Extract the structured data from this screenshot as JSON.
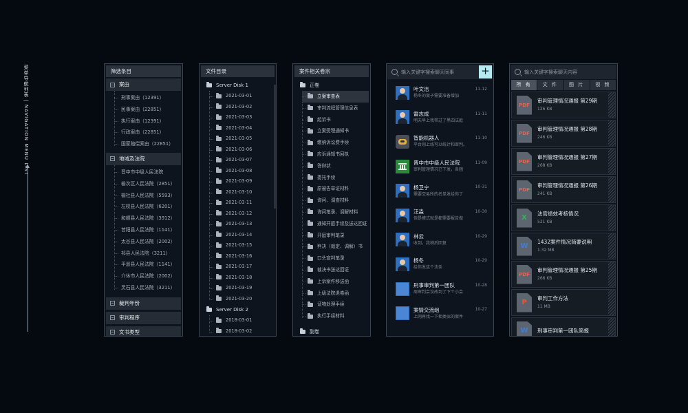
{
  "caption": "菜单导航列表 | NAVIGATION MENU LIST",
  "filter_panel": {
    "title": "筛选条目",
    "groups": [
      {
        "label": "案由",
        "items": [
          "刑事案由（12391）",
          "民事案由（22851）",
          "执行案由（12391）",
          "行政案由（22851）",
          "国家赔偿案由（22851）"
        ]
      },
      {
        "label": "地域及法院",
        "items": [
          "晋中市中级人民法院",
          "榆次区人民法院（2851）",
          "榆社县人民法院（5593）",
          "左权县人民法院（6201）",
          "和顺县人民法院（3912）",
          "昔阳县人民法院（1141）",
          "太谷县人民法院（2002）",
          "祁县人民法院（3211）",
          "平遥县人民法院（1141）",
          "介休市人民法院（2002）",
          "灵石县人民法院（3211）"
        ]
      }
    ],
    "collapsed": [
      "裁判年份",
      "审判程序",
      "文书类型"
    ]
  },
  "file_dir_panel": {
    "title": "文件目录",
    "disks": [
      {
        "name": "Server Disk 1",
        "dates": [
          "2021-03-01",
          "2021-03-02",
          "2021-03-03",
          "2021-03-04",
          "2021-03-05",
          "2021-03-06",
          "2021-03-07",
          "2021-03-08",
          "2021-03-09",
          "2021-03-10",
          "2021-03-11",
          "2021-03-12",
          "2021-03-13",
          "2021-03-14",
          "2021-03-15",
          "2021-03-16",
          "2021-03-17",
          "2021-03-18",
          "2021-03-19",
          "2021-03-20"
        ]
      },
      {
        "name": "Server Disk 2",
        "dates": [
          "2018-03-01",
          "2018-03-02"
        ]
      }
    ]
  },
  "case_panel": {
    "title": "案件相关卷宗",
    "main_volume": "正卷",
    "items": [
      "立案审查表",
      "审判流程管理信息表",
      "起诉书",
      "立案受理通知书",
      "缴纳诉讼费手续",
      "应诉通知书回执",
      "答辩状",
      "委托手续",
      "原被告举证材料",
      "询问、调查材料",
      "询问笔录、调解材料",
      "通知开庭手续及送达回证",
      "开庭审判笔录",
      "判决（裁定、调解）书",
      "口头宣判笔录",
      "裁决书送达回证",
      "上诉案件移送函",
      "上级法院退卷函",
      "证物处理手续",
      "执行手续材料"
    ],
    "active_index": 0,
    "sub_volume": "副卷"
  },
  "chat_panel": {
    "search_placeholder": "输入关键字搜索聊天同事",
    "add_symbol": "+",
    "contacts": [
      {
        "name": "叶文洁",
        "msg": "杨冬的案子需要准备增加",
        "date": "11-12",
        "avatar": "person"
      },
      {
        "name": "雷志成",
        "msg": "明天早上我带过了黑四法庭",
        "date": "11-11",
        "avatar": "person"
      },
      {
        "name": "智能机器人",
        "msg": "平台刚上线可以统计和审判。",
        "date": "11-10",
        "avatar": "robot"
      },
      {
        "name": "晋中市中级人民法院",
        "msg": "审判管理情况已下发，各团",
        "date": "11-09",
        "avatar": "court"
      },
      {
        "name": "杨卫宁",
        "msg": "需要交易所的名单发给你了",
        "date": "10-31",
        "avatar": "person"
      },
      {
        "name": "汪淼",
        "msg": "但是模式就是都需要报告做",
        "date": "10-30",
        "avatar": "person"
      },
      {
        "name": "林云",
        "msg": "收到，我稍后回复",
        "date": "10-29",
        "avatar": "person"
      },
      {
        "name": "杨冬",
        "msg": "给你发这个法条",
        "date": "10-29",
        "avatar": "person"
      },
      {
        "name": "刑事审判第一团队",
        "msg": "周审判会议改到了下个小会",
        "date": "10-28",
        "avatar": "group"
      },
      {
        "name": "案情交流组",
        "msg": "上网再找一下相类似的案件",
        "date": "10-27",
        "avatar": "group"
      }
    ]
  },
  "files_panel": {
    "search_placeholder": "输入关键字搜索聊天内容",
    "tabs": [
      "所 有",
      "文 件",
      "图 片",
      "视 频"
    ],
    "active_tab": 0,
    "files": [
      {
        "type": "pdf",
        "icon_label": "PDF",
        "name": "审判管理情况通报  第29期",
        "size": "126 KB"
      },
      {
        "type": "pdf",
        "icon_label": "PDF",
        "name": "审判管理情况通报  第28期",
        "size": "246 KB"
      },
      {
        "type": "pdf",
        "icon_label": "PDF",
        "name": "审判管理情况通报  第27期",
        "size": "268 KB"
      },
      {
        "type": "pdf",
        "icon_label": "PDF",
        "name": "审判管理情况通报  第26期",
        "size": "241 KB"
      },
      {
        "type": "x",
        "icon_label": "X",
        "name": "法官绩效考核情况",
        "size": "521 KB"
      },
      {
        "type": "w",
        "icon_label": "W",
        "name": "1432案件情况简要说明",
        "size": "1.32 MB"
      },
      {
        "type": "pdf",
        "icon_label": "PDF",
        "name": "审判管理情况通报  第25期",
        "size": "266 KB"
      },
      {
        "type": "p",
        "icon_label": "P",
        "name": "审判工作方法",
        "size": "11 MB"
      },
      {
        "type": "w",
        "icon_label": "W",
        "name": "刑事审判第一团队简报",
        "size": ""
      }
    ]
  }
}
